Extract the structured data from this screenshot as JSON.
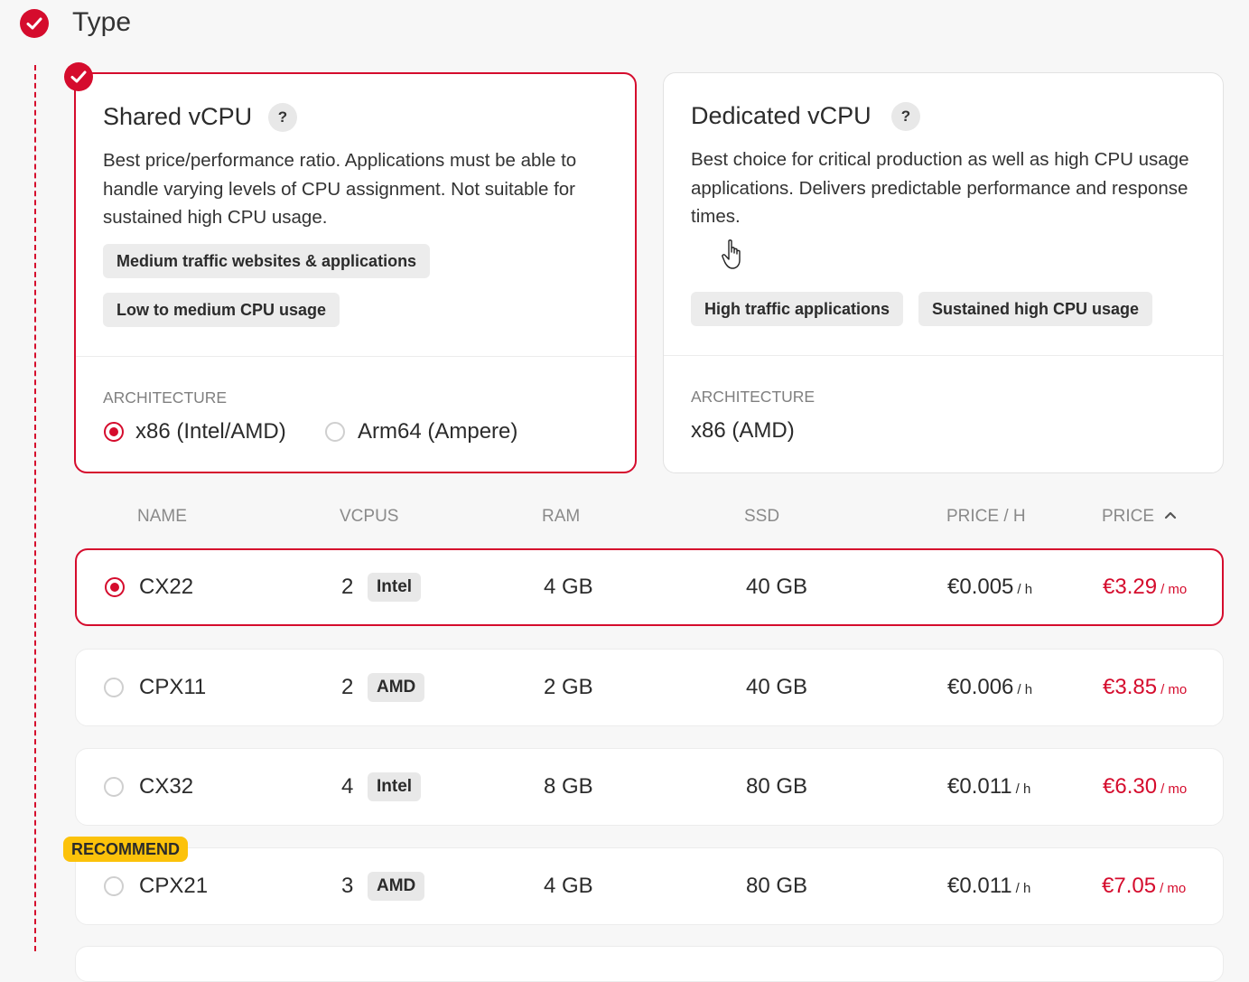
{
  "section": {
    "title": "Type"
  },
  "cards": {
    "shared": {
      "title": "Shared vCPU",
      "help": "?",
      "description": "Best price/performance ratio. Applications must be able to handle varying levels of CPU assignment. Not suitable for sustained high CPU usage.",
      "tags": [
        "Medium traffic websites & applications",
        "Low to medium CPU usage"
      ],
      "arch_label": "ARCHITECTURE",
      "arch_options": [
        "x86 (Intel/AMD)",
        "Arm64 (Ampere)"
      ],
      "arch_selected": "x86 (Intel/AMD)"
    },
    "dedicated": {
      "title": "Dedicated vCPU",
      "help": "?",
      "description": "Best choice for critical production as well as high CPU usage applications. Delivers predictable performance and response times.",
      "tags": [
        "High traffic applications",
        "Sustained high CPU usage"
      ],
      "arch_label": "ARCHITECTURE",
      "arch_value": "x86 (AMD)"
    }
  },
  "table": {
    "headers": [
      "NAME",
      "VCPUS",
      "RAM",
      "SSD",
      "PRICE / H",
      "PRICE"
    ],
    "sort_icon": "chevron-up-icon",
    "rows": [
      {
        "name": "CX22",
        "vcpus": "2",
        "cpu": "Intel",
        "ram": "4 GB",
        "ssd": "40 GB",
        "price_h": "€0.005",
        "unit_h": "/ h",
        "price_mo": "€3.29",
        "unit_mo": "/ mo"
      },
      {
        "name": "CPX11",
        "vcpus": "2",
        "cpu": "AMD",
        "ram": "2 GB",
        "ssd": "40 GB",
        "price_h": "€0.006",
        "unit_h": "/ h",
        "price_mo": "€3.85",
        "unit_mo": "/ mo"
      },
      {
        "name": "CX32",
        "vcpus": "4",
        "cpu": "Intel",
        "ram": "8 GB",
        "ssd": "80 GB",
        "price_h": "€0.011",
        "unit_h": "/ h",
        "price_mo": "€6.30",
        "unit_mo": "/ mo"
      },
      {
        "name": "CPX21",
        "vcpus": "3",
        "cpu": "AMD",
        "ram": "4 GB",
        "ssd": "80 GB",
        "price_h": "€0.011",
        "unit_h": "/ h",
        "price_mo": "€7.05",
        "unit_mo": "/ mo",
        "badge": "RECOMMEND"
      }
    ],
    "selected_row": "CX22"
  },
  "colors": {
    "accent": "#d50c2d",
    "badge": "#fcc20a",
    "background": "#f7f7f7"
  }
}
